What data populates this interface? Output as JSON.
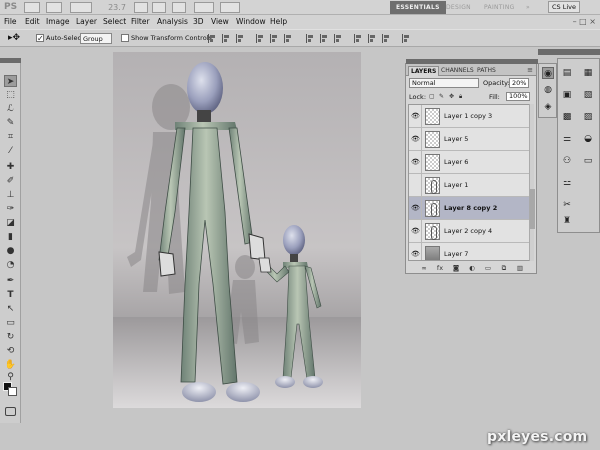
{
  "app": {
    "logo": "PS",
    "zoom": "23.7",
    "workspaces": [
      "ESSENTIALS",
      "DESIGN",
      "PAINTING"
    ],
    "workspace_more": "»",
    "cs_live": "CS Live"
  },
  "menu": [
    "File",
    "Edit",
    "Image",
    "Layer",
    "Select",
    "Filter",
    "Analysis",
    "3D",
    "View",
    "Window",
    "Help"
  ],
  "window_controls": "– □ ×",
  "options_bar": {
    "auto_select_label": "Auto-Select:",
    "auto_select_checked": true,
    "auto_select_value": "Group",
    "transform_controls_label": "Show Transform Controls",
    "transform_controls_checked": false
  },
  "layers_panel": {
    "tabs": [
      "LAYERS",
      "CHANNELS",
      "PATHS"
    ],
    "active_tab": "LAYERS",
    "blend_mode": "Normal",
    "opacity_label": "Opacity:",
    "opacity_value": "20%",
    "lock_label": "Lock:",
    "fill_label": "Fill:",
    "fill_value": "100%",
    "layers": [
      {
        "name": "Layer 1 copy 3",
        "visible": true,
        "selected": false
      },
      {
        "name": "Layer 5",
        "visible": true,
        "selected": false
      },
      {
        "name": "Layer 6",
        "visible": true,
        "selected": false
      },
      {
        "name": "Layer 1",
        "visible": false,
        "selected": false
      },
      {
        "name": "Layer 8 copy 2",
        "visible": true,
        "selected": true
      },
      {
        "name": "Layer 2 copy 4",
        "visible": true,
        "selected": false
      },
      {
        "name": "Layer 7",
        "visible": true,
        "selected": false
      }
    ]
  },
  "watermark": "pxleyes.com",
  "colors": {
    "foreground": "#111111",
    "background": "#ffffff",
    "selected_layer": "#b3b6c6",
    "active_workspace": "#6e6e6e"
  },
  "tools": [
    "move-tool",
    "marquee-tool",
    "lasso-tool",
    "quick-select-tool",
    "crop-tool",
    "eyedropper-tool",
    "healing-brush-tool",
    "brush-tool",
    "clone-stamp-tool",
    "history-brush-tool",
    "eraser-tool",
    "gradient-tool",
    "blur-tool",
    "dodge-tool",
    "pen-tool",
    "type-tool",
    "path-select-tool",
    "rectangle-tool",
    "3d-rotate-tool",
    "3d-orbit-tool",
    "hand-tool",
    "zoom-tool"
  ]
}
